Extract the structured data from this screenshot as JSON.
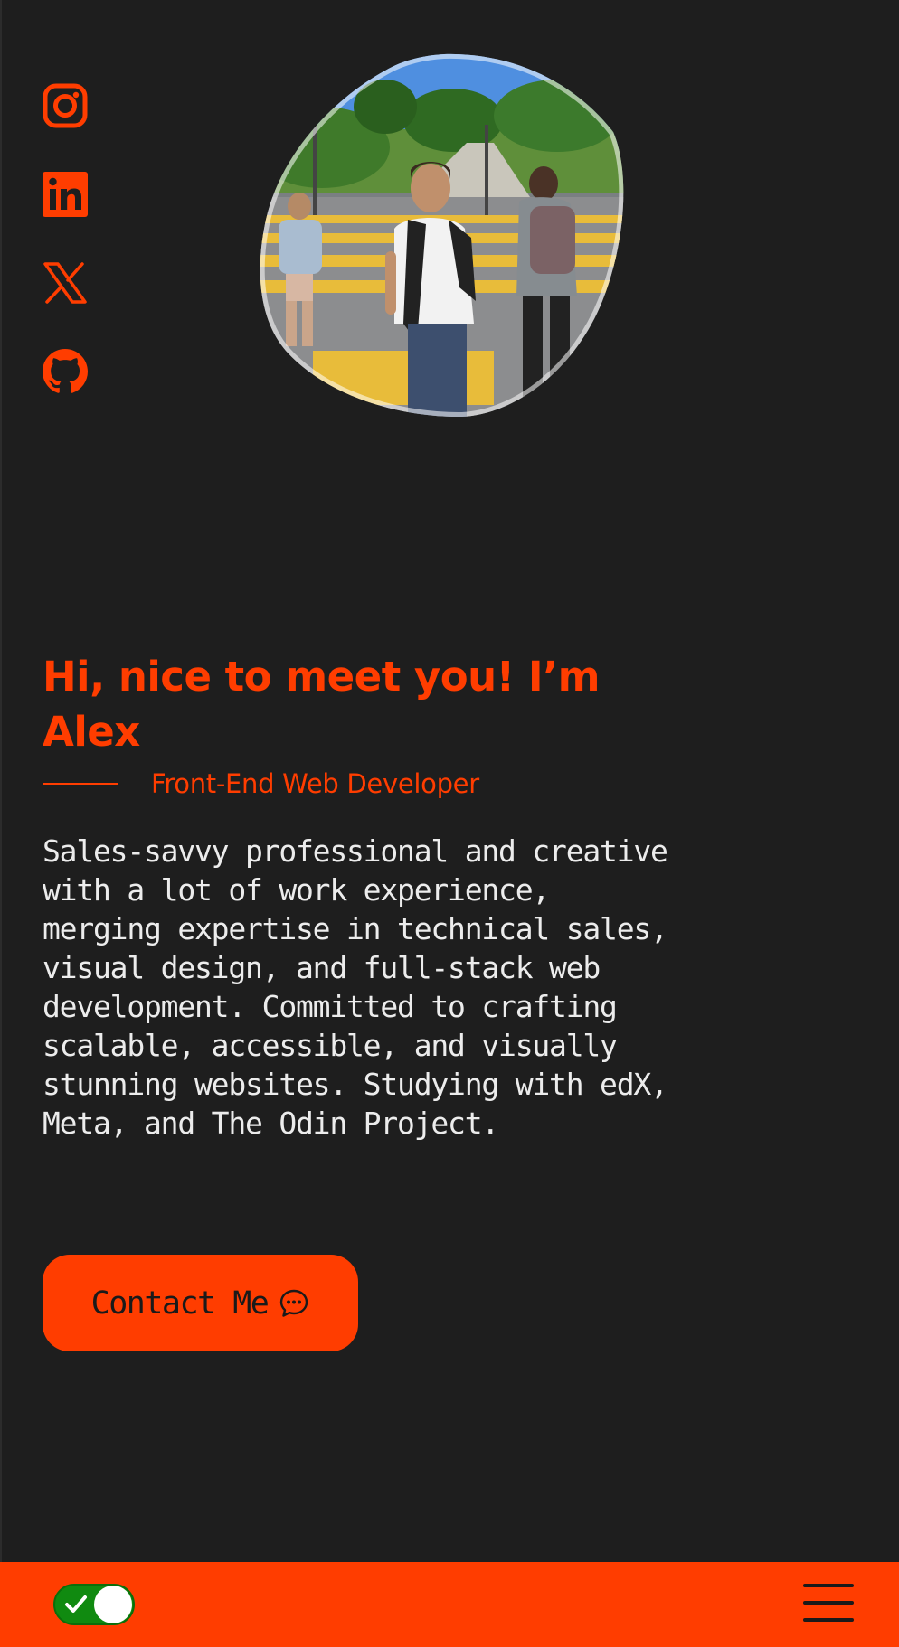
{
  "social": [
    {
      "name": "Instagram",
      "icon": "instagram-icon"
    },
    {
      "name": "LinkedIn",
      "icon": "linkedin-icon"
    },
    {
      "name": "X",
      "icon": "x-icon"
    },
    {
      "name": "GitHub",
      "icon": "github-icon"
    }
  ],
  "hero": {
    "headline": "Hi, nice to meet you! I’m Alex",
    "role": "Front-End Web Developer",
    "bio": "Sales-savvy professional and creative with a lot of work experience, merging expertise in technical sales, visual design, and full-stack web development. Committed to crafting scalable, accessible, and visually stunning websites. Studying with edX, Meta, and The Odin Project.",
    "contact_label": "Contact Me",
    "contact_icon": "chat-bubble-icon"
  },
  "footer": {
    "theme_toggle_on": true,
    "menu_icon": "hamburger-menu-icon"
  },
  "colors": {
    "accent": "#ff3d00",
    "background": "#1e1e1e",
    "text": "#ececec",
    "toggle_on": "#108a10"
  }
}
